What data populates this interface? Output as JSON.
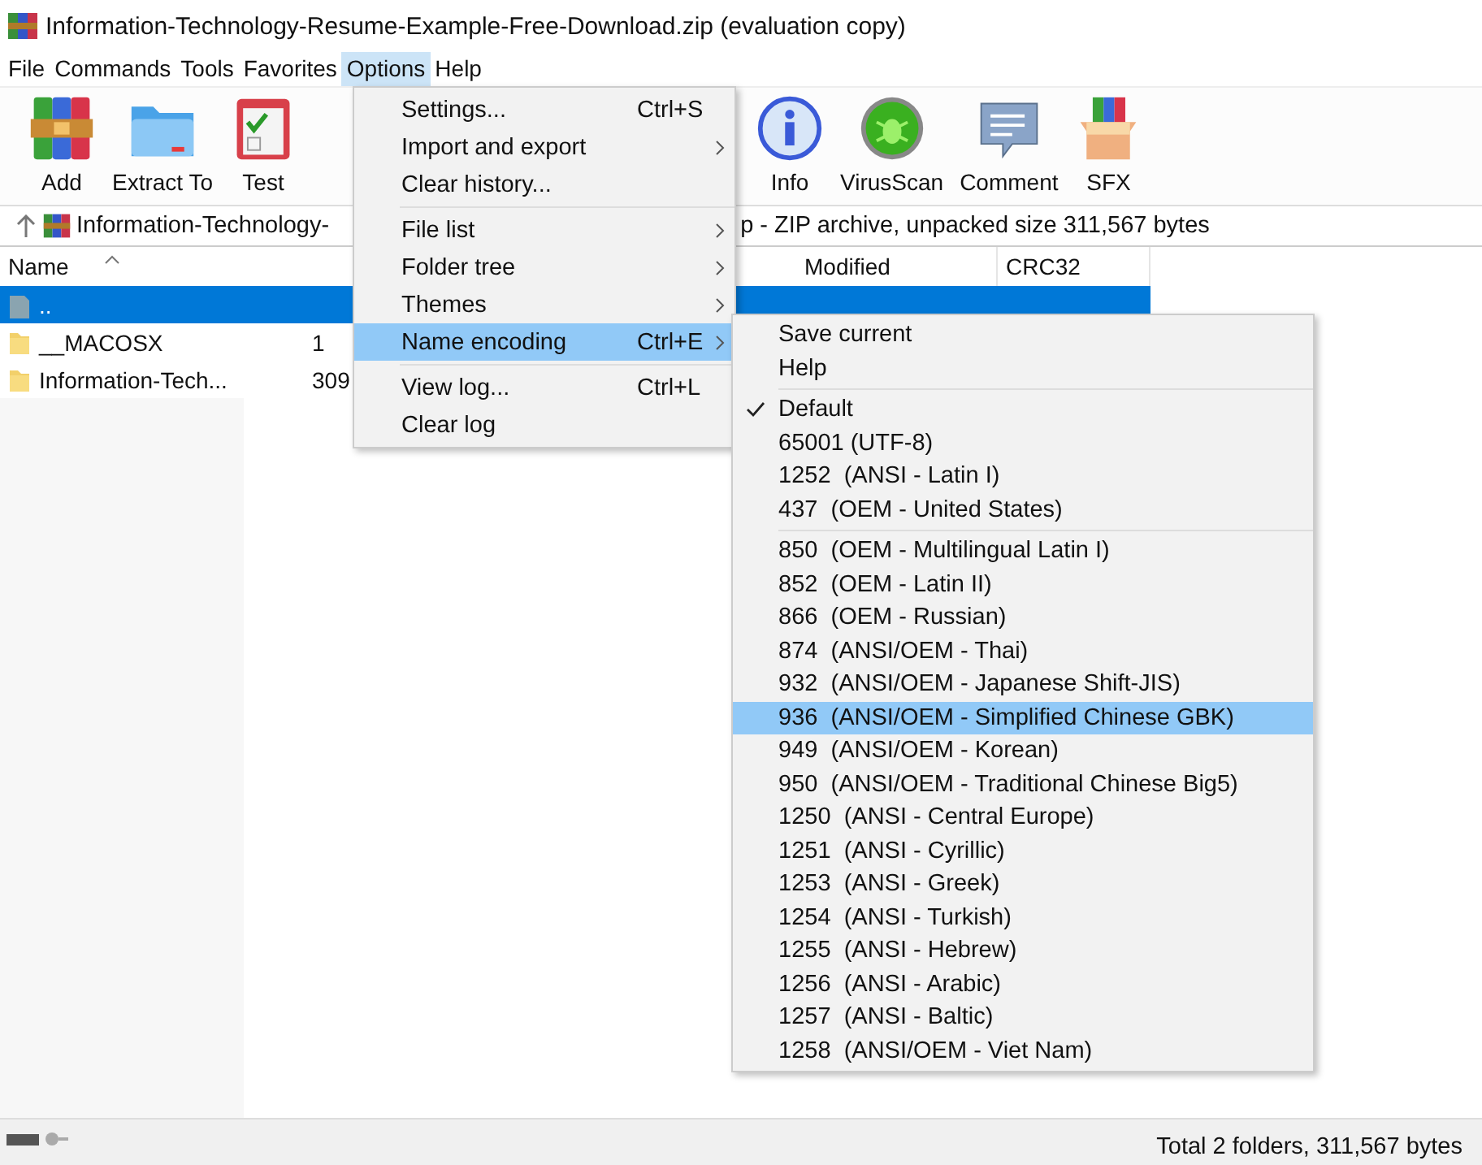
{
  "window": {
    "title": "Information-Technology-Resume-Example-Free-Download.zip (evaluation copy)"
  },
  "menu_bar": [
    {
      "label": "File",
      "selected": false
    },
    {
      "label": "Commands",
      "selected": false
    },
    {
      "label": "Tools",
      "selected": false
    },
    {
      "label": "Favorites",
      "selected": false
    },
    {
      "label": "Options",
      "selected": true
    },
    {
      "label": "Help",
      "selected": false
    }
  ],
  "toolbar": [
    {
      "kind": "add",
      "label": "Add"
    },
    {
      "kind": "extract",
      "label": "Extract To"
    },
    {
      "kind": "test",
      "label": "Test"
    },
    {
      "kind": "gap"
    },
    {
      "kind": "info",
      "label": "Info"
    },
    {
      "kind": "virus",
      "label": "VirusScan"
    },
    {
      "kind": "comment",
      "label": "Comment"
    },
    {
      "kind": "sfx",
      "label": "SFX"
    }
  ],
  "address_bar": {
    "path": "Information-Technology-",
    "description": "p - ZIP archive, unpacked size 311,567 bytes"
  },
  "file_list": {
    "columns": [
      {
        "label": "Name",
        "sorted": true
      },
      {
        "label": "Modified",
        "sorted": false
      },
      {
        "label": "CRC32",
        "sorted": false
      }
    ],
    "rows": [
      {
        "kind": "up",
        "name": "..",
        "size": "",
        "selected": true
      },
      {
        "kind": "folder",
        "name": "__MACOSX",
        "size": "1",
        "selected": false
      },
      {
        "kind": "folder",
        "name": "Information-Tech...",
        "size": "309",
        "selected": false
      }
    ]
  },
  "options_menu": [
    {
      "kind": "item",
      "label": "Settings...",
      "shortcut": "Ctrl+S",
      "submenu": false,
      "selected": false
    },
    {
      "kind": "item",
      "label": "Import and export",
      "submenu": true,
      "selected": false
    },
    {
      "kind": "item",
      "label": "Clear history...",
      "submenu": false,
      "selected": false
    },
    {
      "kind": "separator"
    },
    {
      "kind": "item",
      "label": "File list",
      "submenu": true,
      "selected": false
    },
    {
      "kind": "item",
      "label": "Folder tree",
      "submenu": true,
      "selected": false
    },
    {
      "kind": "item",
      "label": "Themes",
      "submenu": true,
      "selected": false
    },
    {
      "kind": "item",
      "label": "Name encoding",
      "shortcut": "Ctrl+E",
      "submenu": true,
      "selected": true
    },
    {
      "kind": "separator"
    },
    {
      "kind": "item",
      "label": "View log...",
      "shortcut": "Ctrl+L",
      "submenu": false,
      "selected": false
    },
    {
      "kind": "item",
      "label": "Clear log",
      "submenu": false,
      "selected": false
    }
  ],
  "encoding_menu": [
    {
      "kind": "item",
      "label": "Save current",
      "checked": false,
      "selected": false
    },
    {
      "kind": "item",
      "label": "Help",
      "checked": false,
      "selected": false
    },
    {
      "kind": "separator"
    },
    {
      "kind": "item",
      "label": "Default",
      "checked": true,
      "selected": false
    },
    {
      "kind": "item",
      "label": "65001 (UTF-8)",
      "checked": false,
      "selected": false
    },
    {
      "kind": "item",
      "label": "1252  (ANSI - Latin I)",
      "checked": false,
      "selected": false
    },
    {
      "kind": "item",
      "label": "437  (OEM - United States)",
      "checked": false,
      "selected": false
    },
    {
      "kind": "separator"
    },
    {
      "kind": "item",
      "label": "850  (OEM - Multilingual Latin I)",
      "checked": false,
      "selected": false
    },
    {
      "kind": "item",
      "label": "852  (OEM - Latin II)",
      "checked": false,
      "selected": false
    },
    {
      "kind": "item",
      "label": "866  (OEM - Russian)",
      "checked": false,
      "selected": false
    },
    {
      "kind": "item",
      "label": "874  (ANSI/OEM - Thai)",
      "checked": false,
      "selected": false
    },
    {
      "kind": "item",
      "label": "932  (ANSI/OEM - Japanese Shift-JIS)",
      "checked": false,
      "selected": false
    },
    {
      "kind": "item",
      "label": "936  (ANSI/OEM - Simplified Chinese GBK)",
      "checked": false,
      "selected": true
    },
    {
      "kind": "item",
      "label": "949  (ANSI/OEM - Korean)",
      "checked": false,
      "selected": false
    },
    {
      "kind": "item",
      "label": "950  (ANSI/OEM - Traditional Chinese Big5)",
      "checked": false,
      "selected": false
    },
    {
      "kind": "item",
      "label": "1250  (ANSI - Central Europe)",
      "checked": false,
      "selected": false
    },
    {
      "kind": "item",
      "label": "1251  (ANSI - Cyrillic)",
      "checked": false,
      "selected": false
    },
    {
      "kind": "item",
      "label": "1253  (ANSI - Greek)",
      "checked": false,
      "selected": false
    },
    {
      "kind": "item",
      "label": "1254  (ANSI - Turkish)",
      "checked": false,
      "selected": false
    },
    {
      "kind": "item",
      "label": "1255  (ANSI - Hebrew)",
      "checked": false,
      "selected": false
    },
    {
      "kind": "item",
      "label": "1256  (ANSI - Arabic)",
      "checked": false,
      "selected": false
    },
    {
      "kind": "item",
      "label": "1257  (ANSI - Baltic)",
      "checked": false,
      "selected": false
    },
    {
      "kind": "item",
      "label": "1258  (ANSI/OEM - Viet Nam)",
      "checked": false,
      "selected": false
    }
  ],
  "status_bar": {
    "text": "Total 2 folders, 311,567 bytes"
  }
}
